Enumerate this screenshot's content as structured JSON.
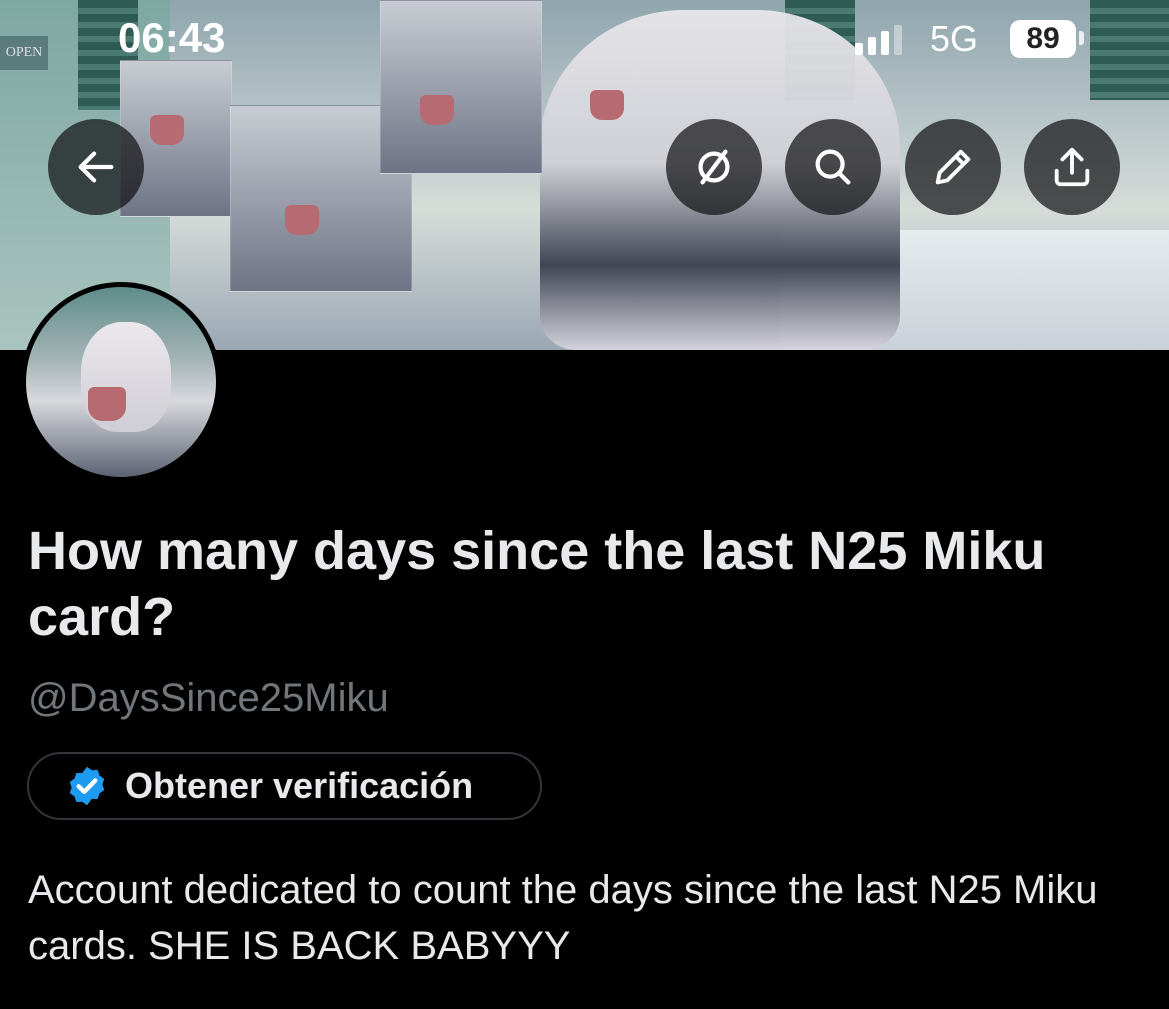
{
  "status_bar": {
    "time": "06:43",
    "network": "5G",
    "battery": "89"
  },
  "banner": {
    "sign_text": "OPEN"
  },
  "toolbar": {
    "back_icon": "arrow-left-icon",
    "grok_icon": "grok-icon",
    "search_icon": "search-icon",
    "edit_icon": "pencil-icon",
    "share_icon": "share-icon"
  },
  "profile": {
    "display_name": "How many days since the last N25 Miku card?",
    "handle": "@DaysSince25Miku",
    "verification_label": "Obtener verificación",
    "bio": "Account dedicated to count the days since the last N25 Miku cards. SHE IS BACK BABYYY"
  },
  "colors": {
    "background": "#000000",
    "text": "#e7e9ea",
    "muted": "#71767b",
    "verified_blue": "#1d9bf0",
    "pill_border": "#333639"
  }
}
